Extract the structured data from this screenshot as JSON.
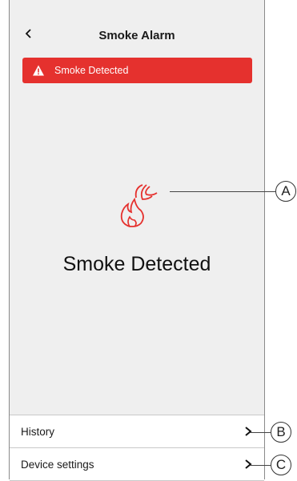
{
  "header": {
    "title": "Smoke Alarm",
    "back_icon": "chevron-left-icon"
  },
  "banner": {
    "text": "Smoke Detected",
    "icon": "warning-icon",
    "color": "#e5312e"
  },
  "main": {
    "status_icon": "smoke-alarm-icon",
    "status_text": "Smoke Detected",
    "icon_color": "#e5312e"
  },
  "list": [
    {
      "label": "History",
      "icon": "chevron-right-icon"
    },
    {
      "label": "Device settings",
      "icon": "chevron-right-icon"
    }
  ],
  "callouts": [
    "A",
    "B",
    "C"
  ]
}
